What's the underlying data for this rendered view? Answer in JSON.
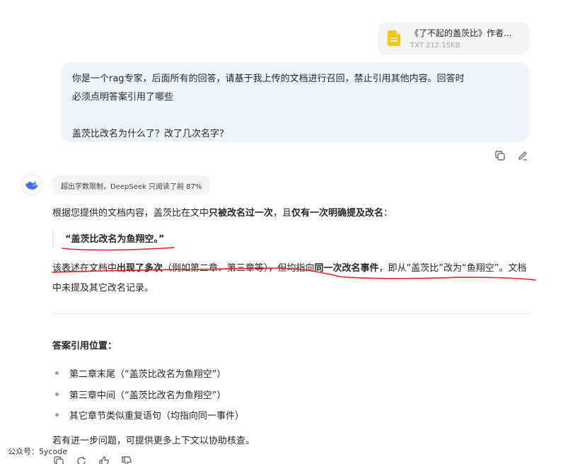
{
  "file": {
    "name": "《了不起的盖茨比》作者...",
    "meta": "TXT 212.15KB",
    "icon": "document-icon",
    "icon_color": "#f5c518"
  },
  "user_message": {
    "line1": "你是一个rag专家，后面所有的回答，请基于我上传的文档进行召回，禁止引用其他内容。回答时",
    "line2": "必须点明答案引用了哪些",
    "line3": "盖茨比改名为什么了？改了几次名字？"
  },
  "assistant": {
    "avatar_icon": "whale-logo-icon",
    "notice": "超出字数限制，DeepSeek 只阅读了前 87%",
    "para1": {
      "a": "根据您提供的文档内容，盖茨比在文中",
      "b": "只被改名过一次",
      "c": "，且",
      "d": "仅有一次明确提及改名",
      "e": "："
    },
    "quote": "“盖茨比改名为鱼翔空。”",
    "para2": {
      "a": "该表述在文档中",
      "b": "出现了多次",
      "c": "（例如第二章、第三章等），但均指向",
      "d": "同一次改名事件",
      "e": "，即从“盖茨比”改为“鱼翔空”。文档中未提及其它改名记录。"
    },
    "citation_title": "答案引用位置：",
    "citations": [
      "第二章末尾（“盖茨比改名为鱼翔空”）",
      "第三章中间（“盖茨比改名为鱼翔空”）",
      "其它章节类似重复语句（均指向同一事件）"
    ],
    "closing": "若有进一步问题，可提供更多上下文以协助核查。"
  },
  "watermark": "公众号：5ycode",
  "colors": {
    "user_bubble": "#eef4fe",
    "annotation": "#e0201c",
    "brand": "#4d6bfe"
  }
}
